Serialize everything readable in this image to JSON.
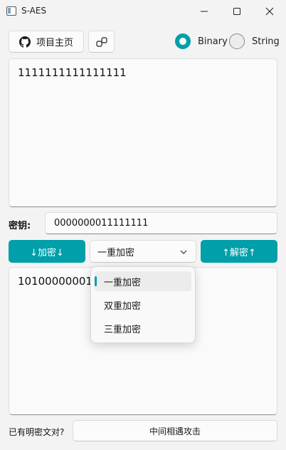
{
  "window": {
    "title": "S-AES",
    "icon": "app-window-icon",
    "controls": [
      "minimize-icon",
      "maximize-icon",
      "close-icon"
    ]
  },
  "toolbar": {
    "project_home_label": "项目主页",
    "project_home_icon": "github-icon",
    "settings_icon": "link-icon",
    "mode_options": [
      {
        "label": "Binary",
        "selected": true
      },
      {
        "label": "String",
        "selected": false
      }
    ]
  },
  "input_text": "1111111111111111",
  "key": {
    "label": "密钥:",
    "value": "0000000011111111"
  },
  "actions": {
    "encrypt_label": "↓加密↓",
    "decrypt_label": "↑解密↑",
    "mode_selected": "一重加密",
    "mode_options": [
      "一重加密",
      "双重加密",
      "三重加密"
    ]
  },
  "output_text": "1010000000101",
  "footer": {
    "question": "已有明密文对?",
    "attack_label": "中间相遇攻击"
  },
  "colors": {
    "accent": "#009faa",
    "background": "#f3f3f3"
  }
}
